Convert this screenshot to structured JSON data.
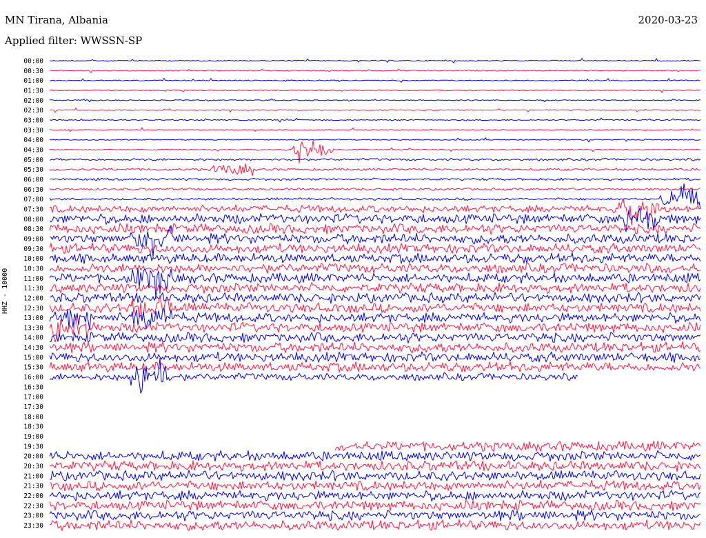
{
  "header": {
    "station": "MN Tirana, Albania",
    "date": "2020-03-23",
    "filter": "Applied filter: WWSSN-SP"
  },
  "chart_data": {
    "type": "line",
    "ylabel": "HHZ - 10000",
    "colors": {
      "even": "#0000ee",
      "odd": "#ff1744"
    },
    "x_unit": "minutes past line start",
    "xlim": [
      0,
      30
    ],
    "amplitude_scale": "relative, 0-9 per 1/16 of a line",
    "lines": [
      {
        "time": "00:00",
        "amp": "0000000000000000"
      },
      {
        "time": "00:30",
        "amp": "0000000000000000"
      },
      {
        "time": "01:00",
        "amp": "0000000000000000"
      },
      {
        "time": "01:30",
        "amp": "0000000000000000"
      },
      {
        "time": "02:00",
        "amp": "0000000000000000"
      },
      {
        "time": "02:30",
        "amp": "0000000000000000"
      },
      {
        "time": "03:00",
        "amp": "0000000000000000"
      },
      {
        "time": "03:30",
        "amp": "0000000000000000"
      },
      {
        "time": "04:00",
        "amp": "0000000000000000"
      },
      {
        "time": "04:30",
        "amp": "0000006000000000"
      },
      {
        "time": "05:00",
        "amp": "1111111111111111"
      },
      {
        "time": "05:30",
        "amp": "1111511111111111"
      },
      {
        "time": "06:00",
        "amp": "1111111111111111"
      },
      {
        "time": "06:30",
        "amp": "1111111111111111"
      },
      {
        "time": "07:00",
        "amp": "1111111111111119"
      },
      {
        "time": "07:30",
        "amp": "3333333333333393"
      },
      {
        "time": "08:00",
        "amp": "4444444444444494"
      },
      {
        "time": "08:30",
        "amp": "4444444444444444"
      },
      {
        "time": "09:00",
        "amp": "4494444444444444"
      },
      {
        "time": "09:30",
        "amp": "4444444444444444"
      },
      {
        "time": "10:00",
        "amp": "4444444444444444"
      },
      {
        "time": "10:30",
        "amp": "4444444444444444"
      },
      {
        "time": "11:00",
        "amp": "4494444444444444"
      },
      {
        "time": "11:30",
        "amp": "4444444444444444"
      },
      {
        "time": "12:00",
        "amp": "4444444444444444"
      },
      {
        "time": "12:30",
        "amp": "4494444444444444"
      },
      {
        "time": "13:00",
        "amp": "7494444444444444"
      },
      {
        "time": "13:30",
        "amp": "8444444444444444"
      },
      {
        "time": "14:00",
        "amp": "4444444444444444"
      },
      {
        "time": "14:30",
        "amp": "4444444444444444"
      },
      {
        "time": "15:00",
        "amp": "4444444444444444"
      },
      {
        "time": "15:30",
        "amp": "4444444444444444"
      },
      {
        "time": "16:00",
        "amp": "3393333333333"
      },
      {
        "time": "16:30",
        "amp": ""
      },
      {
        "time": "17:00",
        "amp": ""
      },
      {
        "time": "17:30",
        "amp": ""
      },
      {
        "time": "18:00",
        "amp": ""
      },
      {
        "time": "18:30",
        "amp": ""
      },
      {
        "time": "19:00",
        "amp": ""
      },
      {
        "time": "19:30",
        "amp": "-------444444444"
      },
      {
        "time": "20:00",
        "amp": "4444444444444444"
      },
      {
        "time": "20:30",
        "amp": "4444444444444444"
      },
      {
        "time": "21:00",
        "amp": "4444444444444444"
      },
      {
        "time": "21:30",
        "amp": "4444444444444444"
      },
      {
        "time": "22:00",
        "amp": "4444444444444444"
      },
      {
        "time": "22:30",
        "amp": "4444444444444444"
      },
      {
        "time": "23:00",
        "amp": "4444444444444444"
      },
      {
        "time": "23:30",
        "amp": "4444444444444444"
      }
    ]
  }
}
